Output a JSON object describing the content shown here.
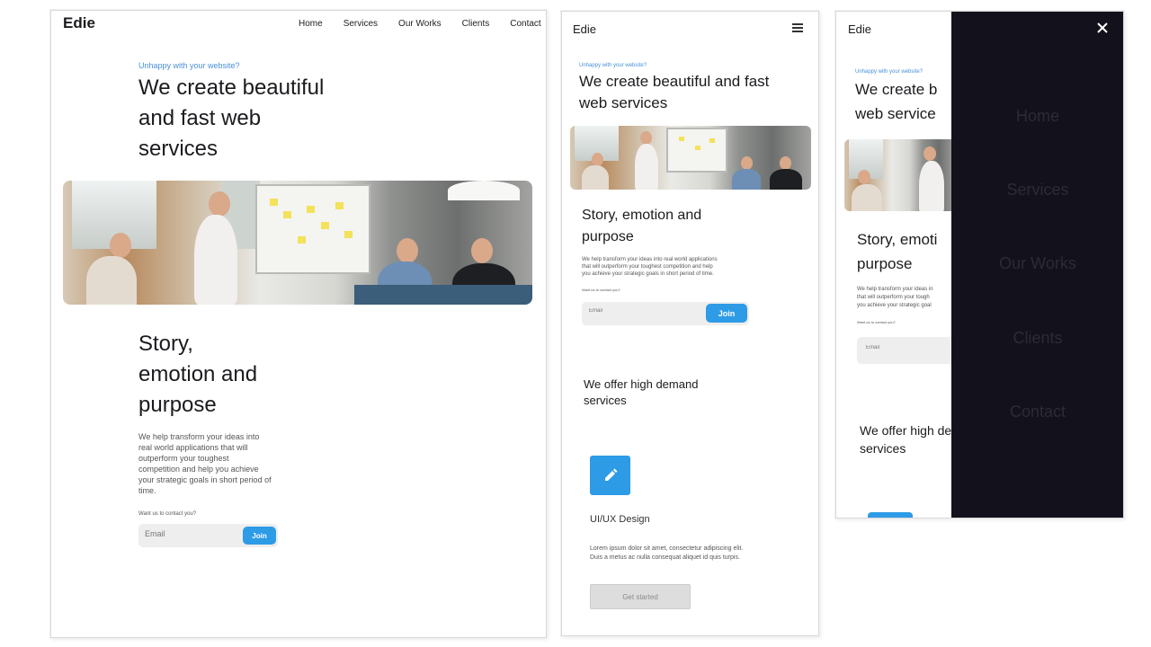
{
  "brand": "Edie",
  "nav": [
    "Home",
    "Services",
    "Our Works",
    "Clients",
    "Contact"
  ],
  "hero": {
    "eyebrow": "Unhappy with your website?",
    "title_desktop": [
      "We create beautiful",
      "and fast web",
      "services"
    ],
    "title_tablet": [
      "We create beautiful and fast",
      "web services"
    ],
    "title_mobile": [
      "We create b",
      "web service"
    ]
  },
  "story": {
    "title_desktop": [
      "Story,",
      "emotion and",
      "purpose"
    ],
    "title_tablet": [
      "Story, emotion and",
      "purpose"
    ],
    "title_mobile": [
      "Story, emoti",
      "purpose"
    ],
    "body_desktop": [
      "We help transform your ideas into",
      "real world applications that will",
      "outperform your toughest",
      "competition and help you achieve",
      "your strategic goals in short period of",
      "time."
    ],
    "body_tablet": [
      "We help transform your ideas into real world applications",
      "that will outperform your toughest competition and help",
      "you achieve your strategic goals in short period of time."
    ],
    "body_mobile": [
      "We help transform your ideas in",
      "that will outperform your tough",
      "you achieve your strategic goal"
    ],
    "contact_prompt": "Want us to contact you?",
    "email_placeholder": "Email",
    "join_label": "Join"
  },
  "services": {
    "title_tablet": [
      "We offer high demand",
      "services"
    ],
    "title_mobile": [
      "We offer high de",
      "services"
    ],
    "card_title": "UI/UX Design",
    "card_body": [
      "Lorem ipsum dolor sit amet, consectetur adipiscing elit.",
      "Duis a metus ac nulla consequat aliquet id quis turpis."
    ],
    "cta_label": "Get started"
  },
  "colors": {
    "accent": "#2e9be6",
    "drawer_bg": "#12111c",
    "drawer_text": "#2c2b36"
  },
  "icons": {
    "menu": "hamburger-menu-icon",
    "close": "close-icon",
    "card": "pencil-icon"
  }
}
